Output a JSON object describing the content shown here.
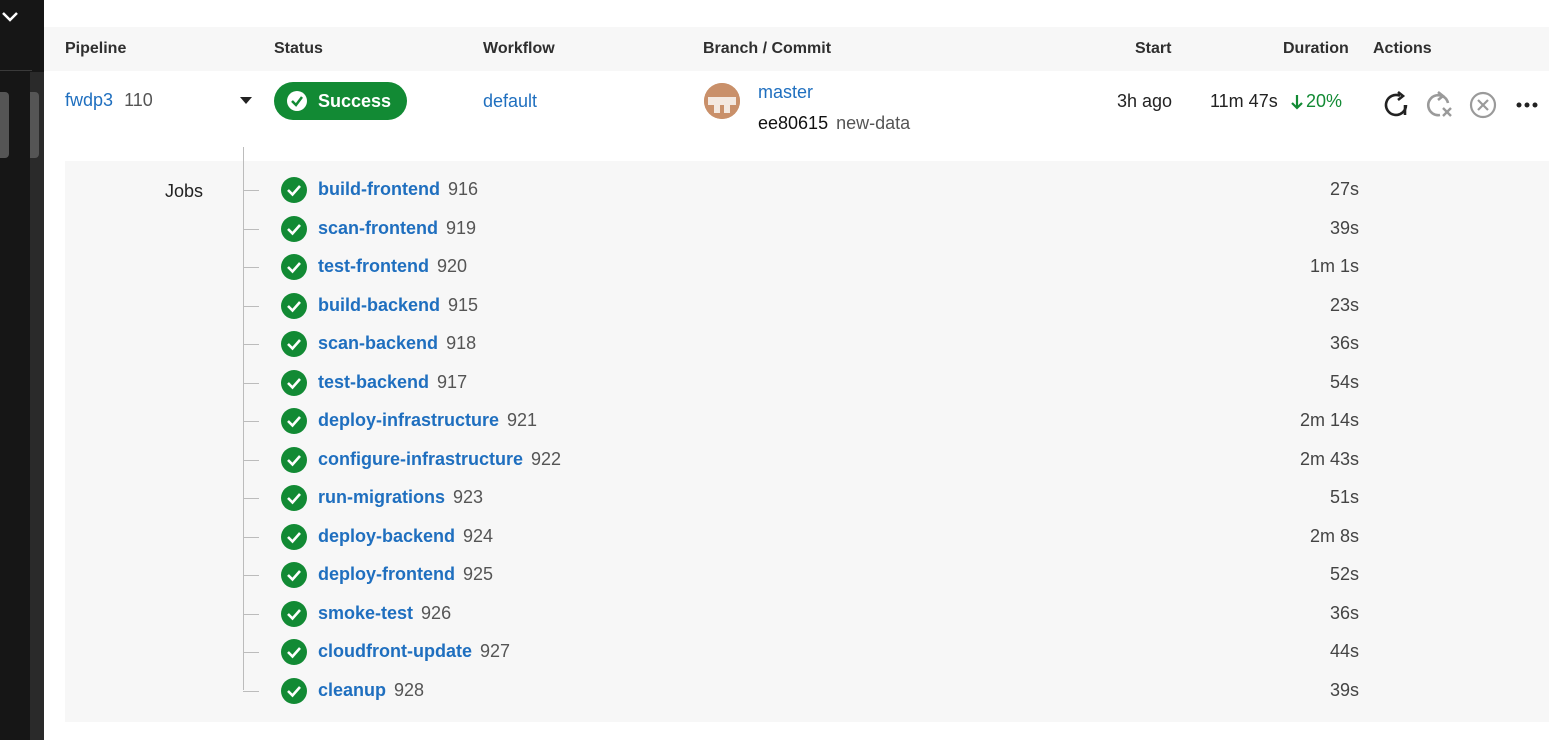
{
  "headers": {
    "pipeline": "Pipeline",
    "status": "Status",
    "workflow": "Workflow",
    "branch_commit": "Branch / Commit",
    "start": "Start",
    "duration": "Duration",
    "actions": "Actions"
  },
  "pipeline": {
    "project": "fwdp3",
    "number": "110",
    "status": "Success",
    "workflow": "default",
    "branch": "master",
    "commit_hash": "ee80615",
    "commit_message": "new-data",
    "start": "3h ago",
    "duration": "11m 47s",
    "change": "20%",
    "change_direction": "down"
  },
  "jobs_label": "Jobs",
  "jobs": [
    {
      "name": "build-frontend",
      "number": "916",
      "duration": "27s"
    },
    {
      "name": "scan-frontend",
      "number": "919",
      "duration": "39s"
    },
    {
      "name": "test-frontend",
      "number": "920",
      "duration": "1m 1s"
    },
    {
      "name": "build-backend",
      "number": "915",
      "duration": "23s"
    },
    {
      "name": "scan-backend",
      "number": "918",
      "duration": "36s"
    },
    {
      "name": "test-backend",
      "number": "917",
      "duration": "54s"
    },
    {
      "name": "deploy-infrastructure",
      "number": "921",
      "duration": "2m 14s"
    },
    {
      "name": "configure-infrastructure",
      "number": "922",
      "duration": "2m 43s"
    },
    {
      "name": "run-migrations",
      "number": "923",
      "duration": "51s"
    },
    {
      "name": "deploy-backend",
      "number": "924",
      "duration": "2m 8s"
    },
    {
      "name": "deploy-frontend",
      "number": "925",
      "duration": "52s"
    },
    {
      "name": "smoke-test",
      "number": "926",
      "duration": "36s"
    },
    {
      "name": "cloudfront-update",
      "number": "927",
      "duration": "44s"
    },
    {
      "name": "cleanup",
      "number": "928",
      "duration": "39s"
    }
  ],
  "colors": {
    "success": "#128a34",
    "link": "#1f6fbf",
    "sidebar": "#161616"
  },
  "icons": {
    "actions": [
      "rerun-icon",
      "rerun-failed-icon",
      "cancel-icon",
      "more-options-icon"
    ],
    "job_status": "success-check-icon"
  }
}
